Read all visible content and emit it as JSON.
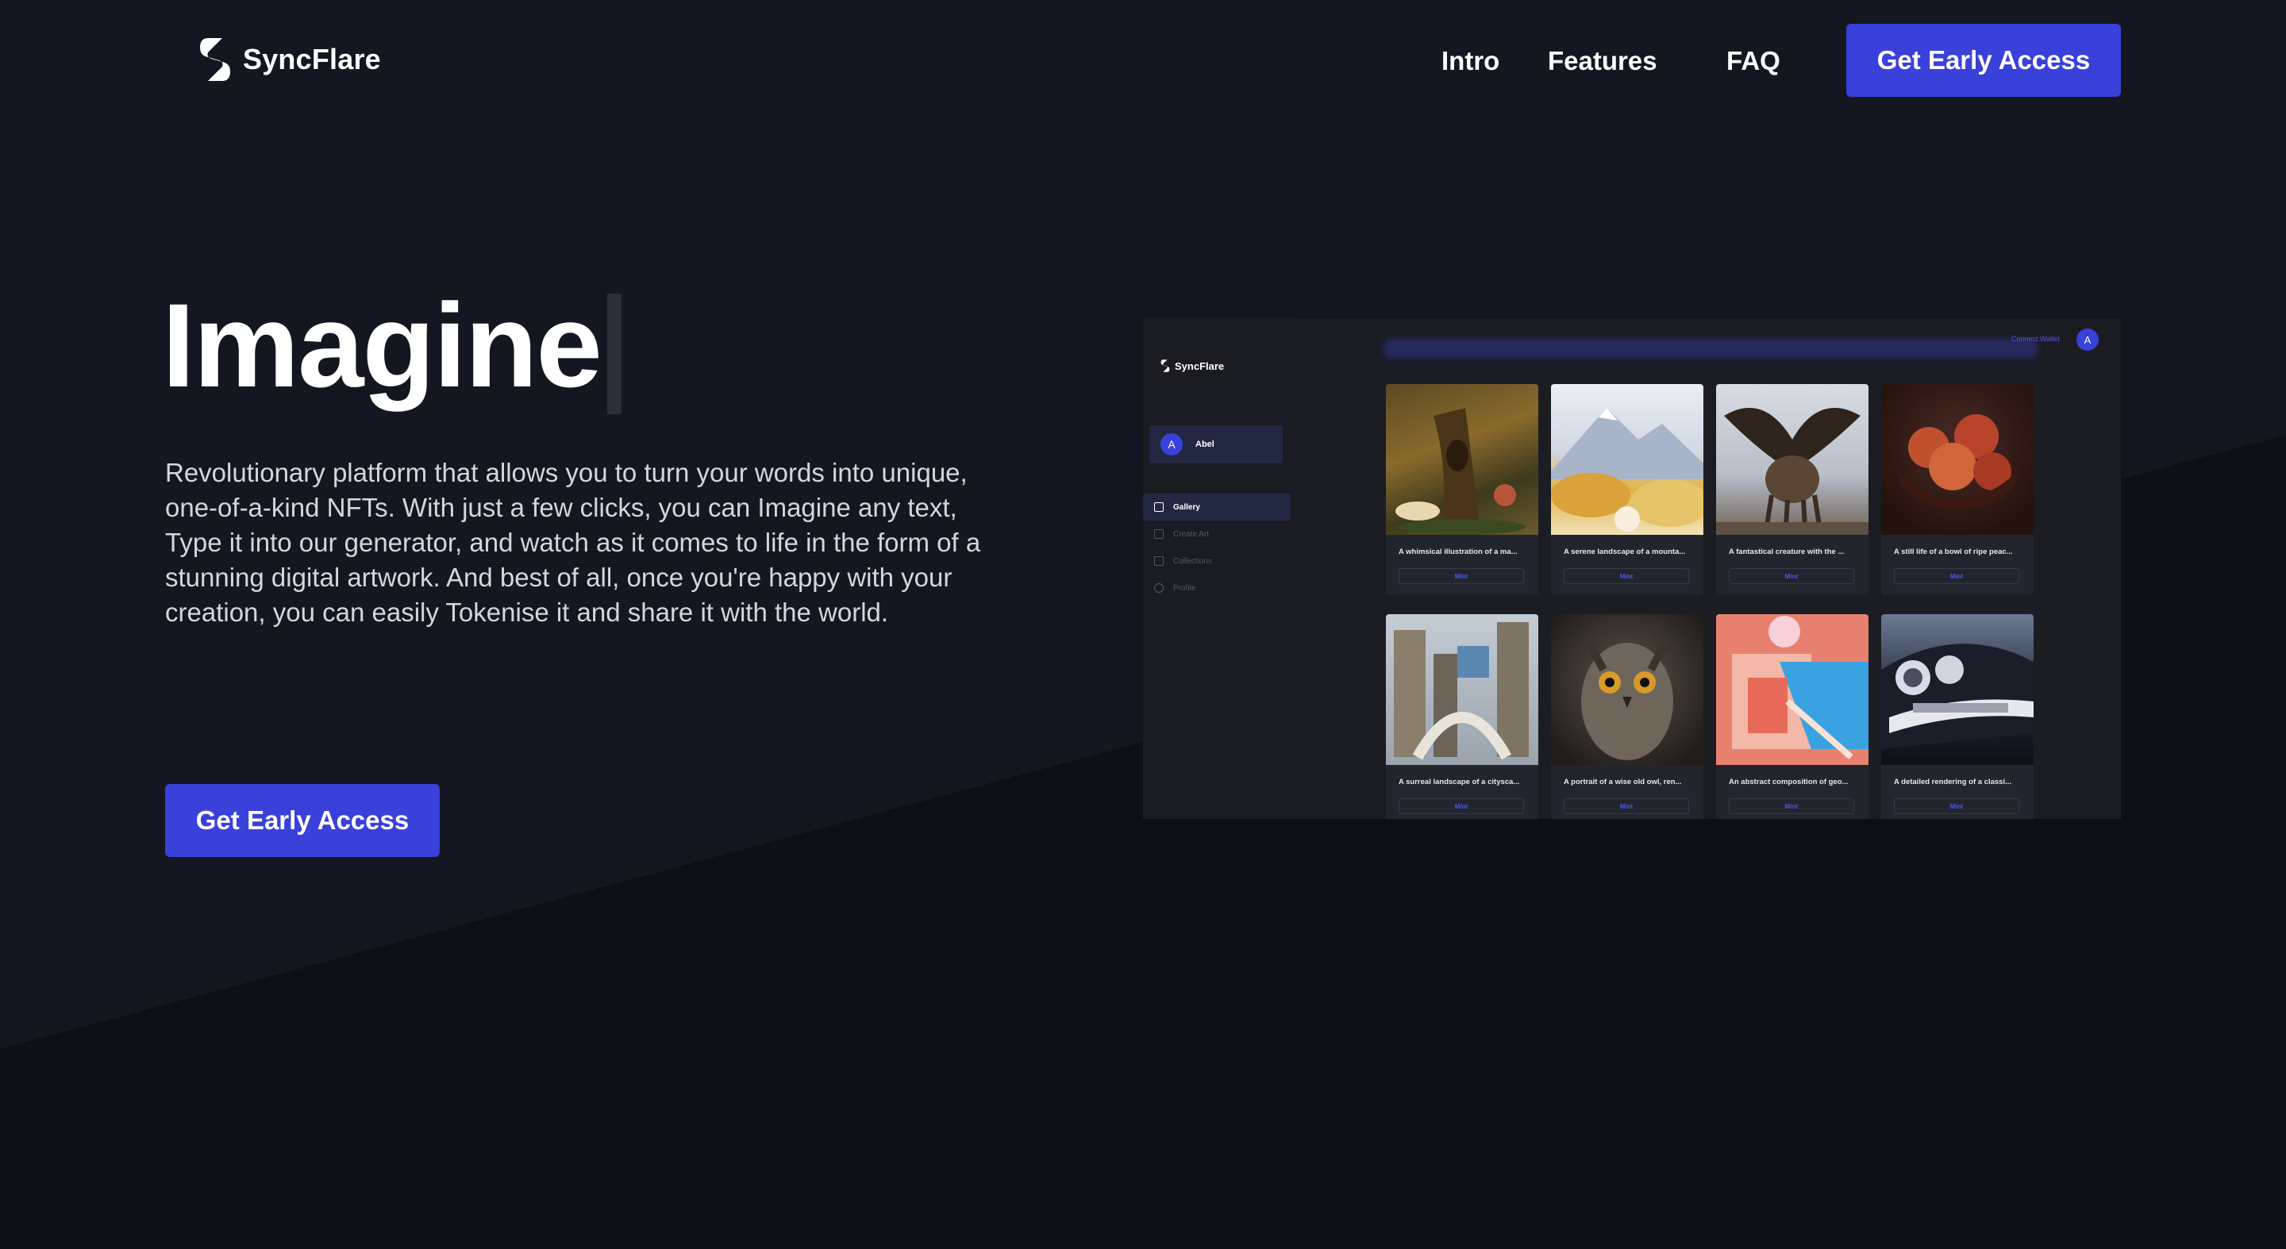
{
  "header": {
    "brand": "SyncFlare",
    "nav": [
      "Intro",
      "Features",
      "FAQ"
    ],
    "cta": "Get Early Access"
  },
  "hero": {
    "headline": "Imagine",
    "description": "Revolutionary platform that allows you to turn your words into unique, one-of-a-kind NFTs. With just a few clicks, you can Imagine any text, Type it into our generator, and watch as it comes to life in the form of a stunning digital artwork. And best of all, once you're happy with your creation, you can easily Tokenise it and share it with the world.",
    "cta": "Get Early Access"
  },
  "preview": {
    "brand": "SyncFlare",
    "user": {
      "initial": "A",
      "name": "Abel"
    },
    "menu": [
      "Gallery",
      "Create Art",
      "Collections",
      "Profile"
    ],
    "connect_wallet": "Connect Wallet",
    "avatar_initial": "A",
    "cards": [
      {
        "caption": "A whimsical illustration of a ma...",
        "button": "Mint"
      },
      {
        "caption": "A serene landscape of a mounta...",
        "button": "Mint"
      },
      {
        "caption": "A fantastical creature with the ...",
        "button": "Mint"
      },
      {
        "caption": "A still life of a bowl of ripe peac...",
        "button": "Mint"
      },
      {
        "caption": "A surreal landscape of a citysca...",
        "button": "Mint"
      },
      {
        "caption": "A portrait of a wise old owl, ren...",
        "button": "Mint"
      },
      {
        "caption": "An abstract composition of geo...",
        "button": "Mint"
      },
      {
        "caption": "A detailed rendering of a classi...",
        "button": "Mint"
      }
    ]
  },
  "colors": {
    "background": "#141720",
    "accent": "#3a40da",
    "text_muted": "#d3d6de"
  }
}
